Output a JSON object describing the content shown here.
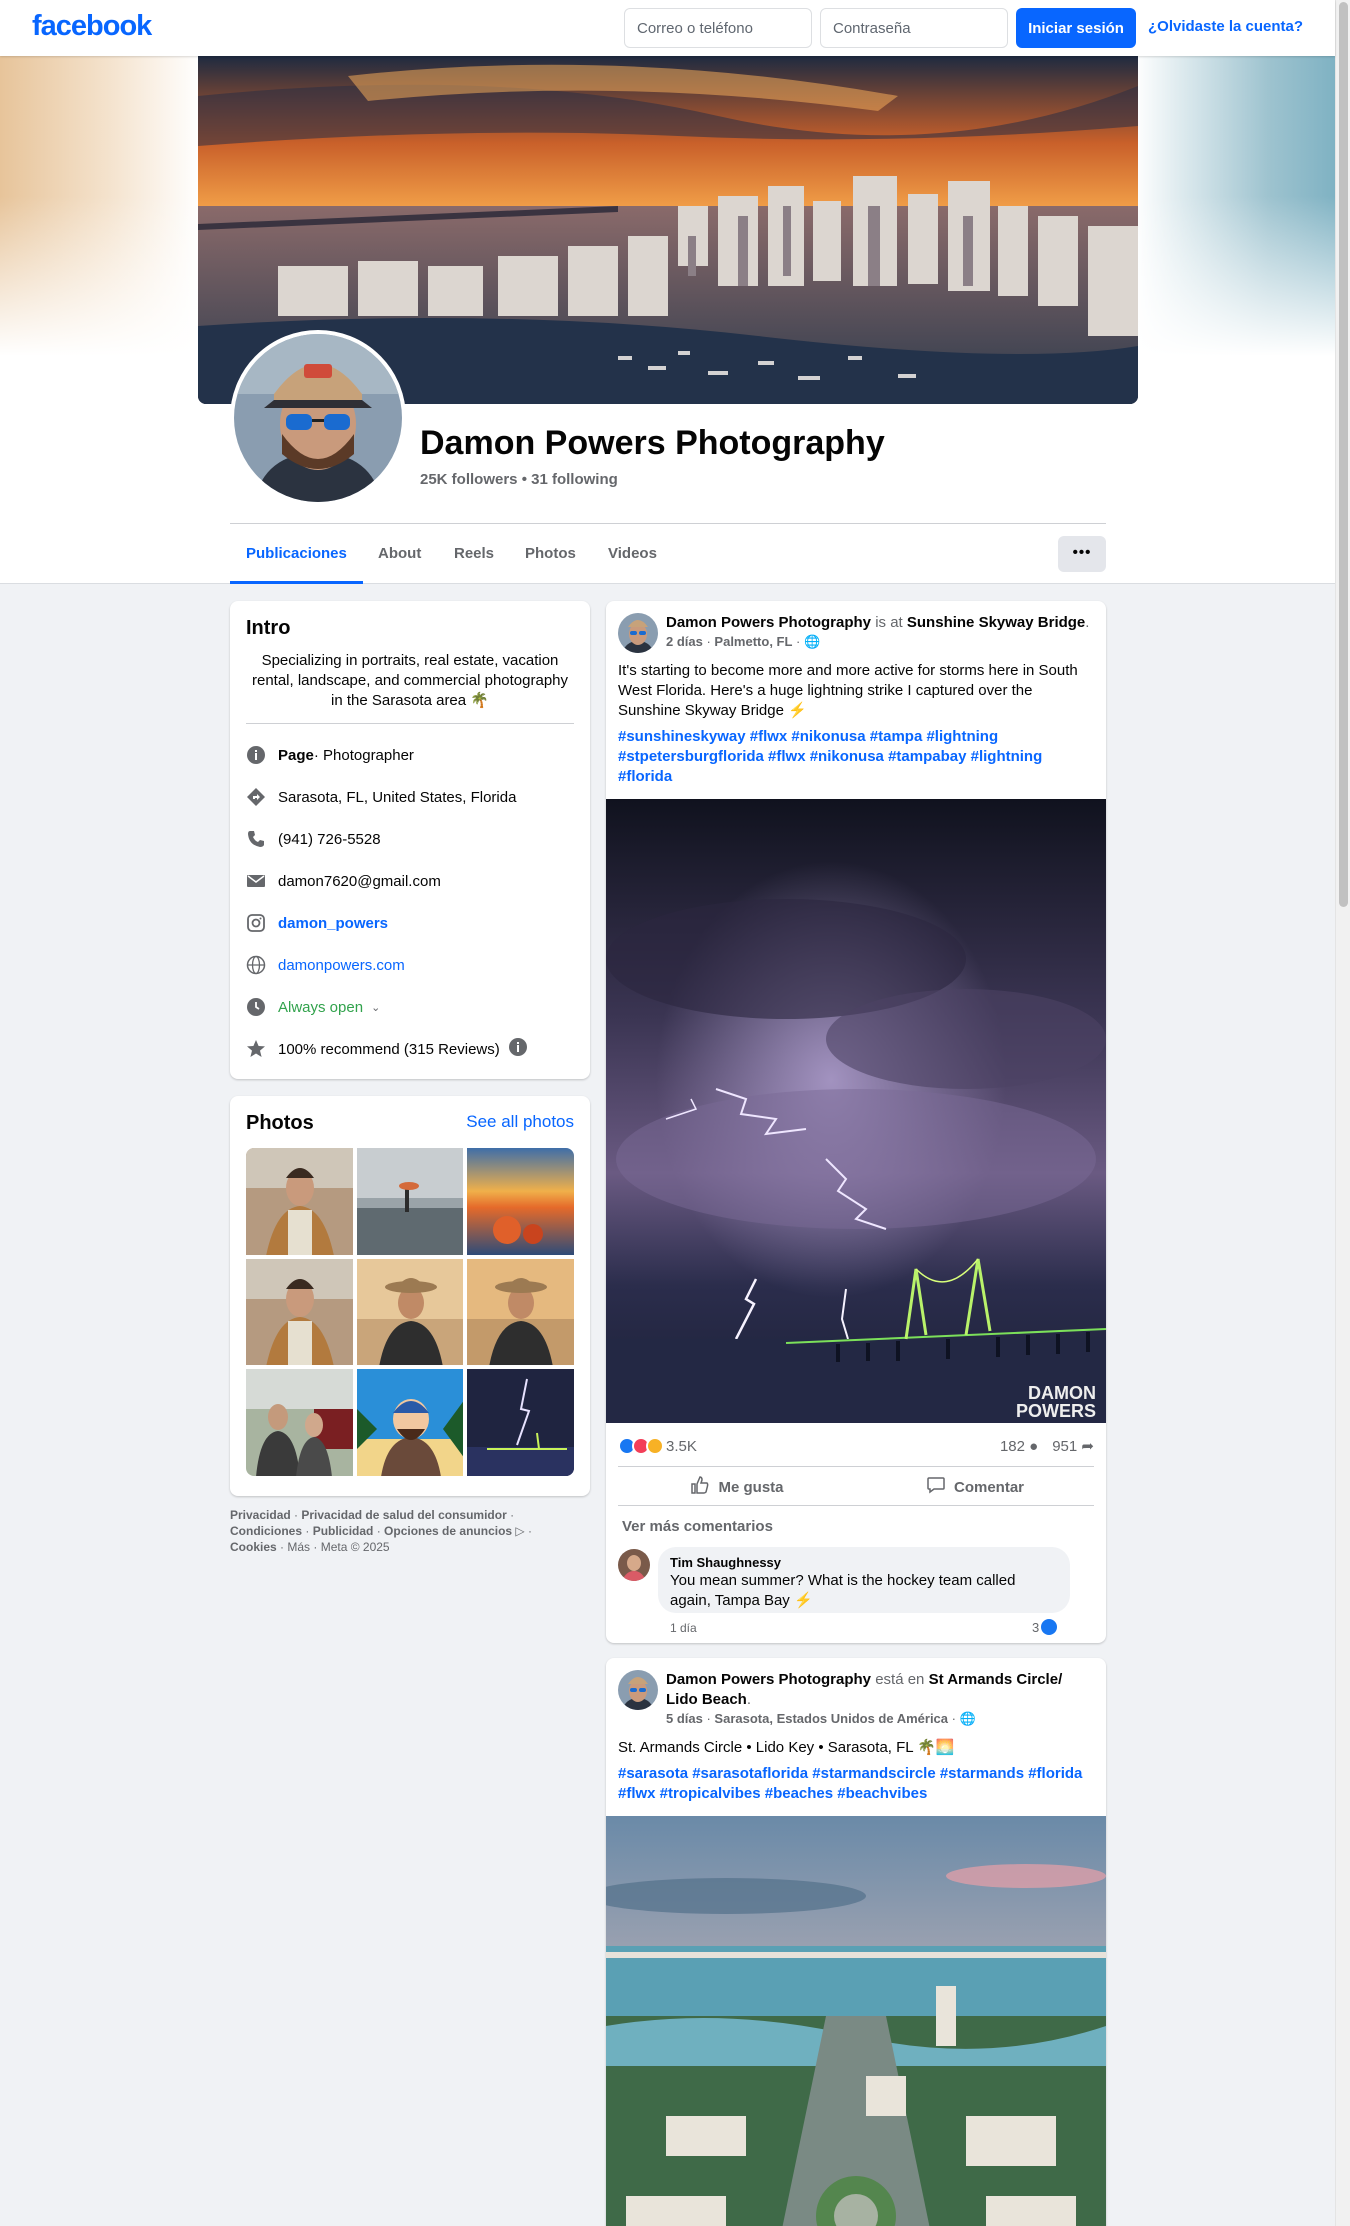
{
  "topbar": {
    "logo": "facebook",
    "email_placeholder": "Correo o teléfono",
    "password_placeholder": "Contraseña",
    "login_label": "Iniciar sesión",
    "forgot_label": "¿Olvidaste la cuenta?"
  },
  "profile": {
    "name": "Damon Powers Photography",
    "followers": "25K followers",
    "following": "31 following",
    "separator": " • "
  },
  "tabs": [
    "Publicaciones",
    "About",
    "Reels",
    "Photos",
    "Videos"
  ],
  "more_label": "•••",
  "intro": {
    "title": "Intro",
    "bio": "Specializing in portraits, real estate, vacation rental, landscape, and commercial photography in the Sarasota area 🌴",
    "category_label": "Page",
    "category_value": " · Photographer",
    "location": "Sarasota, FL, United States, Florida",
    "phone": "(941) 726-5528",
    "email": "damon7620@gmail.com",
    "instagram": "damon_powers",
    "website": "damonpowers.com",
    "hours": "Always open",
    "rating": "100% recommend (315 Reviews)"
  },
  "photos": {
    "title": "Photos",
    "see_all": "See all photos"
  },
  "footer": {
    "line1a": "Privacidad",
    "line1b": "Privacidad de salud del consumidor",
    "line2a": "Condiciones",
    "line2b": "Publicidad",
    "line2c": "Opciones de anuncios",
    "line3a": "Cookies",
    "line3b": "Más",
    "line3c": "Meta © 2025"
  },
  "post1": {
    "author": "Damon Powers Photography",
    "connector": " is at ",
    "place": "Sunshine Skyway Bridge",
    "time": "2 días",
    "location": "Palmetto, FL",
    "text": "It's starting to become more and more active for storms here in South West Florida. Here's a huge lightning strike I captured over the Sunshine Skyway Bridge ⚡",
    "hashtags": "#sunshineskyway #flwx #nikonusa #tampa #lightning #stpetersburgflorida  #flwx #nikonusa #tampabay #lightning #florida",
    "watermark1": "DAMON",
    "watermark2": "POWERS",
    "reaction_count": "3.5K",
    "comment_count": "182",
    "share_count": "951",
    "like_label": "Me gusta",
    "comment_label": "Comentar",
    "more_comments": "Ver más comentarios",
    "comment": {
      "author": "Tim Shaughnessy",
      "text": "You mean summer? What is the hockey team called again, Tampa Bay ⚡",
      "time": "1 día",
      "likes": "3"
    }
  },
  "post2": {
    "author": "Damon Powers Photography",
    "connector": " está en ",
    "place": "St Armands Circle/ Lido Beach",
    "time": "5 días",
    "location": "Sarasota, Estados Unidos de América",
    "text": "St. Armands Circle • Lido Key • Sarasota, FL 🌴🌅",
    "hashtags": "#sarasota #sarasotaflorida #starmandscircle #starmands  #florida #flwx #tropicalvibes #beaches #beachvibes"
  },
  "colors": {
    "brand": "#0866ff",
    "background": "#f0f2f5",
    "secondary_text": "#65676b",
    "open_status": "#31a24c"
  }
}
